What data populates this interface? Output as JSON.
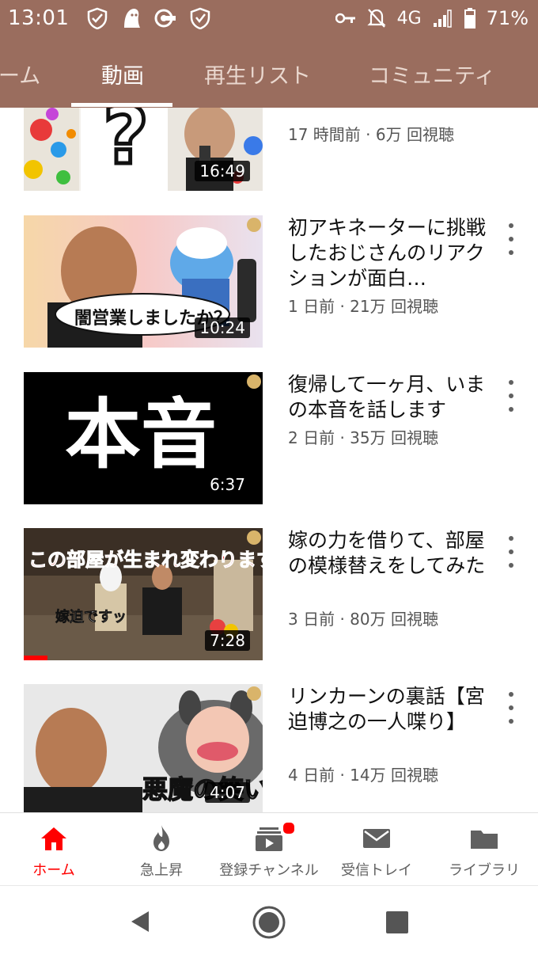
{
  "status_bar": {
    "time": "13:01",
    "network": "4G",
    "battery": "71%",
    "icons": [
      "shield-check-icon",
      "ghost-icon",
      "toggle-icon",
      "vpn-shield-icon",
      "key-icon",
      "bell-off-icon",
      "signal-icon",
      "battery-icon"
    ]
  },
  "tabs": [
    {
      "label": "ーム",
      "active": false
    },
    {
      "label": "動画",
      "active": true
    },
    {
      "label": "再生リスト",
      "active": false
    },
    {
      "label": "コミュニティ",
      "active": false
    }
  ],
  "videos": [
    {
      "title": "",
      "meta": "17 時間前 · 6万 回視聴",
      "duration": "16:49",
      "thumb_text": "?"
    },
    {
      "title": "初アキネーターに挑戦したおじさんのリアクションが面白…",
      "meta": "1 日前 · 21万 回視聴",
      "duration": "10:24",
      "thumb_text": "闇営業しましたか？"
    },
    {
      "title": "復帰して一ヶ月、いまの本音を話します",
      "meta": "2 日前 · 35万 回視聴",
      "duration": "6:37",
      "thumb_text": "本音"
    },
    {
      "title": "嫁の力を借りて、部屋の模様替えをしてみた",
      "meta": "3 日前 · 80万 回視聴",
      "duration": "7:28",
      "thumb_text": "この部屋が生まれ変わります",
      "thumb_text2": "嫁迫ですッ",
      "watched_fraction": 0.1
    },
    {
      "title": "リンカーンの裏話【宮迫博之の一人喋り】",
      "meta": "4 日前 · 14万 回視聴",
      "duration": "4:07",
      "thumb_text": "悪魔の笑い声"
    }
  ],
  "channel_mark": "宮",
  "bottom_nav": [
    {
      "label": "ホーム",
      "icon": "home-icon",
      "active": true
    },
    {
      "label": "急上昇",
      "icon": "flame-icon",
      "active": false
    },
    {
      "label": "登録チャンネル",
      "icon": "subscriptions-icon",
      "active": false,
      "badge": true
    },
    {
      "label": "受信トレイ",
      "icon": "inbox-icon",
      "active": false
    },
    {
      "label": "ライブラリ",
      "icon": "folder-icon",
      "active": false
    }
  ],
  "colors": {
    "brand": "#9a6d5e",
    "accent": "#ff0000"
  }
}
